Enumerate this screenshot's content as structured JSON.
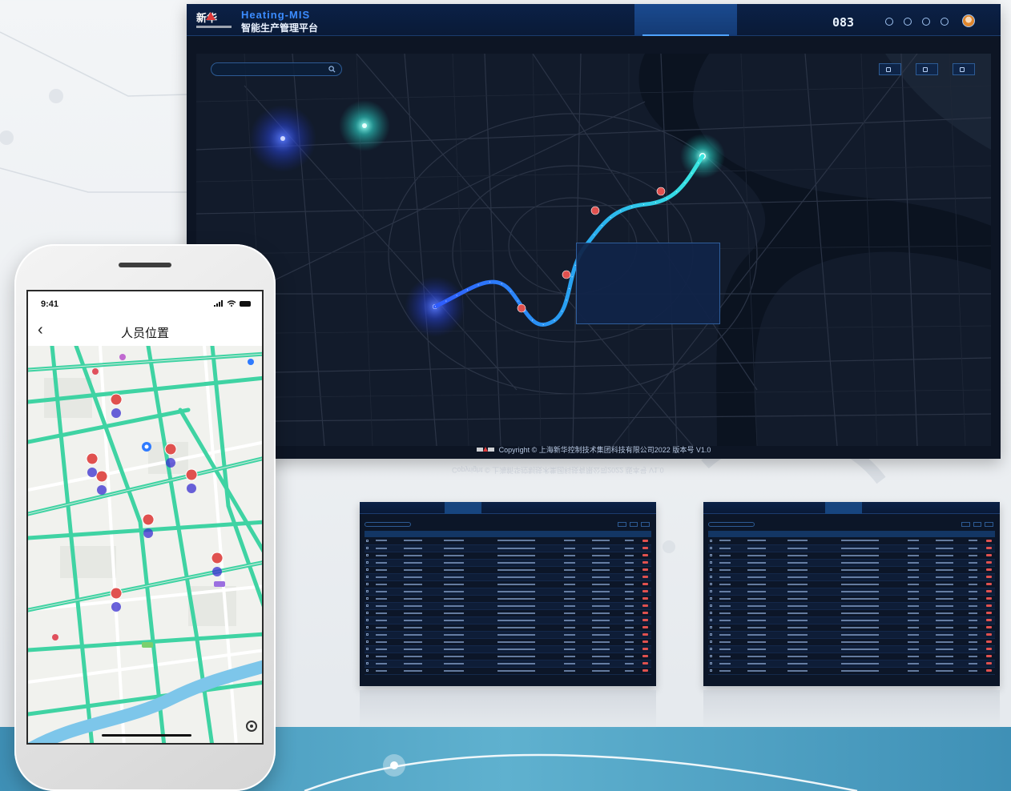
{
  "dashboard": {
    "brand_en": "Heating-MIS",
    "brand_cn": "智能生产管理平台",
    "nav_tabs": [
      "",
      "",
      "",
      "",
      ""
    ],
    "active_tab_index": 3,
    "counter": "083",
    "sub_tabs": [
      "",
      ""
    ],
    "search_placeholder": "",
    "map_buttons": [
      "",
      "",
      ""
    ],
    "tooltip": {
      "rows": [
        {
          "key": "",
          "value": "",
          "extra": ""
        },
        {
          "key": "",
          "value": "",
          "extra": ""
        },
        {
          "key": "",
          "value": "",
          "extra": ""
        },
        {
          "key": "",
          "value": "",
          "extra": ""
        }
      ]
    },
    "footer_copyright": "Copyright © 上海新华控制技术集团科技有限公司2022 版本号 V1.0"
  },
  "phone": {
    "time": "9:41",
    "title": "人员位置",
    "back_icon": "chevron-left-icon"
  },
  "colors": {
    "dashboard_bg": "#0d1524",
    "header_bg": "#0b2147",
    "route_blue": "#2f7bff",
    "route_cyan": "#38e8e0",
    "marker_red": "#e0514f",
    "road_green": "#3fd3a3",
    "river_blue": "#7dc6ea"
  }
}
